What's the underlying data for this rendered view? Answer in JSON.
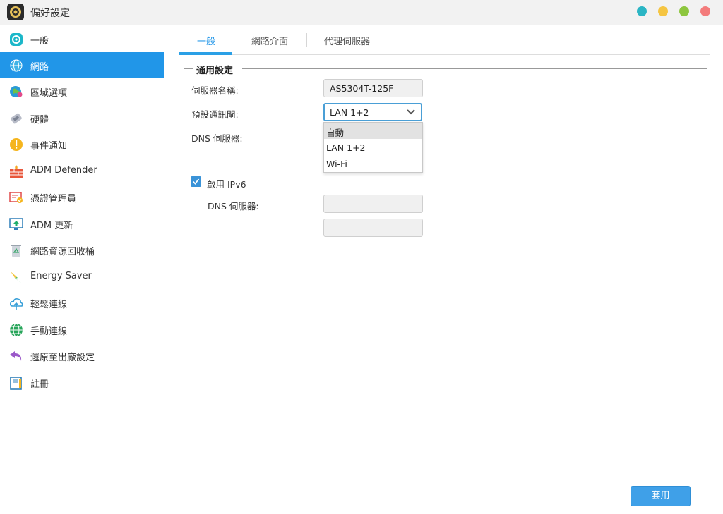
{
  "window": {
    "title": "偏好設定",
    "controls": [
      {
        "name": "minimize-button",
        "color": "#2bb5c4"
      },
      {
        "name": "maximize-button",
        "color": "#f5c542"
      },
      {
        "name": "fullscreen-button",
        "color": "#8dc63f"
      },
      {
        "name": "close-button",
        "color": "#f37b7b"
      }
    ]
  },
  "sidebar": {
    "items": [
      {
        "label": "一般",
        "icon": "general-icon"
      },
      {
        "label": "網路",
        "icon": "globe-icon",
        "active": true
      },
      {
        "label": "區域選項",
        "icon": "region-icon"
      },
      {
        "label": "硬體",
        "icon": "hardware-icon"
      },
      {
        "label": "事件通知",
        "icon": "alert-icon"
      },
      {
        "label": "ADM Defender",
        "icon": "firewall-icon"
      },
      {
        "label": "憑證管理員",
        "icon": "certificate-icon"
      },
      {
        "label": "ADM 更新",
        "icon": "update-icon"
      },
      {
        "label": "網路資源回收桶",
        "icon": "recycle-bin-icon"
      },
      {
        "label": "Energy Saver",
        "icon": "energy-icon"
      },
      {
        "label": "輕鬆連線",
        "icon": "cloud-connect-icon"
      },
      {
        "label": "手動連線",
        "icon": "manual-connect-icon"
      },
      {
        "label": "還原至出廠設定",
        "icon": "restore-icon"
      },
      {
        "label": "註冊",
        "icon": "register-icon"
      }
    ]
  },
  "tabs": [
    {
      "label": "一般",
      "active": true
    },
    {
      "label": "網路介面"
    },
    {
      "label": "代理伺服器"
    }
  ],
  "form": {
    "section_title": "通用設定",
    "server_name_label": "伺服器名稱:",
    "server_name_value": "AS5304T-125F",
    "gateway_label": "預設通訊閘:",
    "gateway_value": "LAN 1+2",
    "gateway_options": [
      "自動",
      "LAN 1+2",
      "Wi-Fi"
    ],
    "dns_label": "DNS 伺服器:",
    "ipv6_label": "啟用 IPv6",
    "ipv6_checked": true,
    "ipv6_dns_label": "DNS 伺服器:",
    "ipv6_dns_1": "",
    "ipv6_dns_2": ""
  },
  "apply_label": "套用",
  "colors": {
    "accent": "#2196e8"
  }
}
